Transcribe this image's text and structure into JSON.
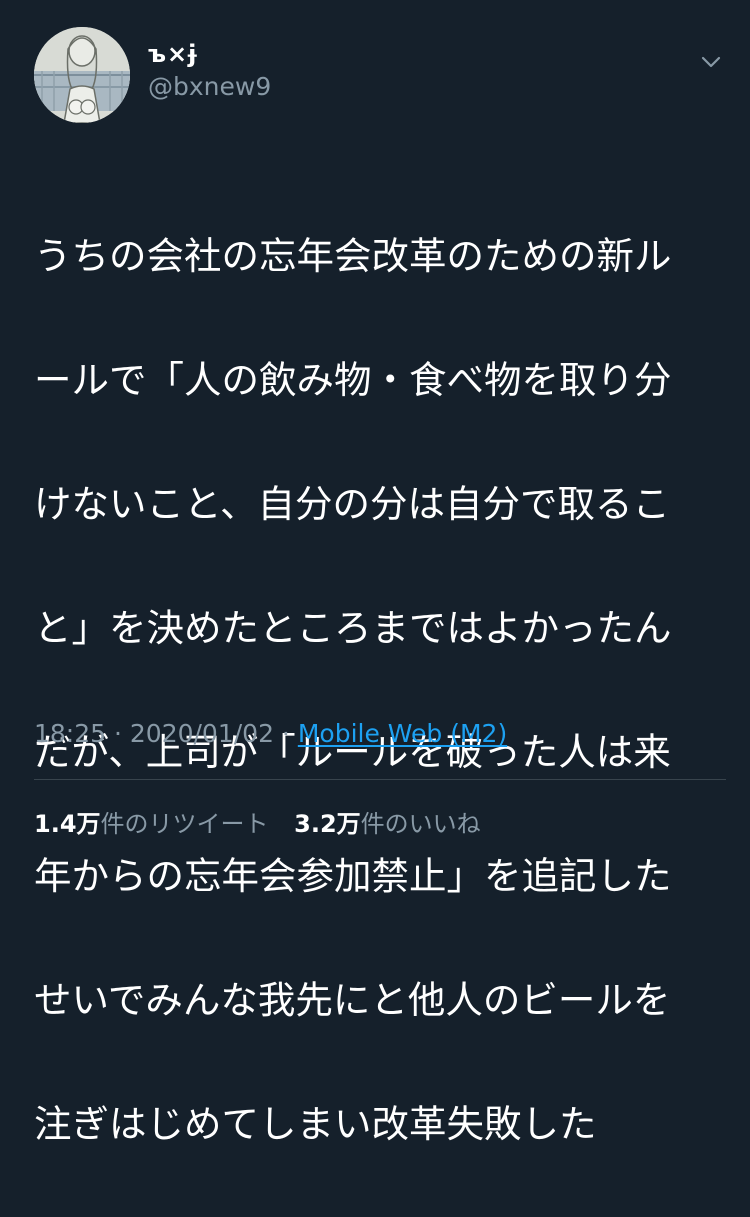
{
  "user": {
    "display_name": "ъ×ɉ",
    "handle": "@bxnew9",
    "avatar_icon": "profile-photo"
  },
  "tweet": {
    "lines": [
      "うちの会社の忘年会改革のための新ル",
      "ールで「人の飲み物・食べ物を取り分",
      "けないこと、自分の分は自分で取るこ",
      "と」を決めたところまではよかったん",
      "だが、上司が「ルールを破った人は来",
      "年からの忘年会参加禁止」を追記した",
      "せいでみんな我先にと他人のビールを",
      "注ぎはじめてしまい改革失敗した"
    ]
  },
  "meta": {
    "time": "18:25",
    "separator": " · ",
    "date": "2020/01/02",
    "source": "Mobile Web (M2)"
  },
  "stats": {
    "retweets_count": "1.4万",
    "retweets_label": "件のリツイート",
    "likes_count": "3.2万",
    "likes_label": "件のいいね"
  },
  "colors": {
    "background": "#15202b",
    "text": "#ffffff",
    "secondary_text": "#8899a6",
    "link": "#1da1f2",
    "divider": "#38444d"
  },
  "icons": {
    "menu": "chevron-down-icon"
  }
}
